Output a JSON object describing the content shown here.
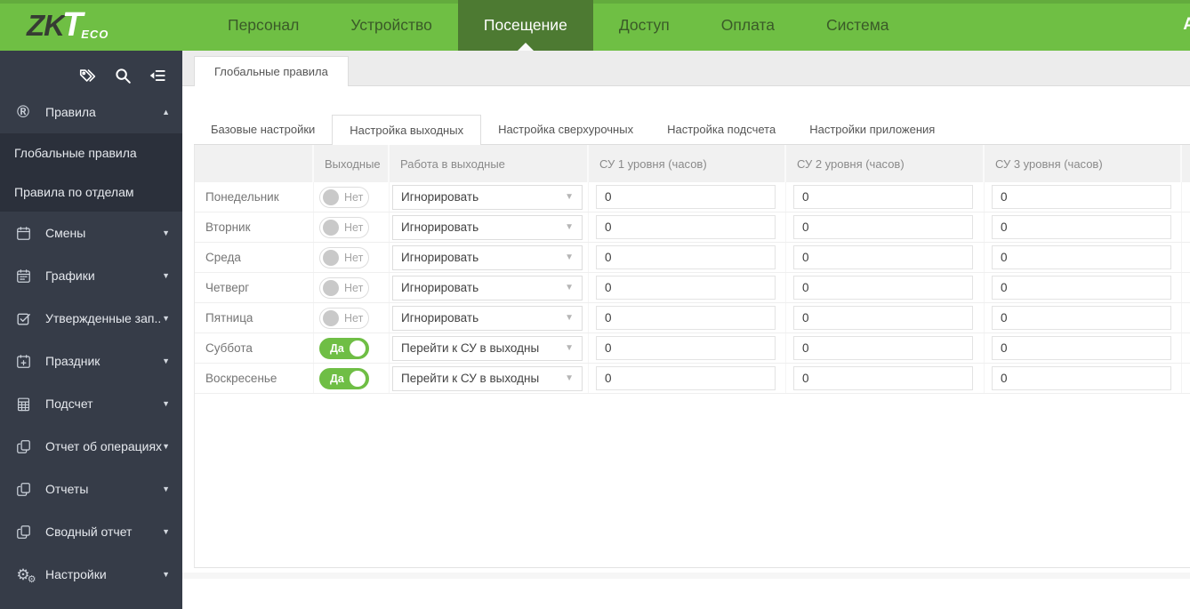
{
  "header": {
    "logo": {
      "zk": "ZK",
      "t": "T",
      "eco": "ECO"
    },
    "nav": [
      {
        "label": "Персонал",
        "active": false
      },
      {
        "label": "Устройство",
        "active": false
      },
      {
        "label": "Посещение",
        "active": true
      },
      {
        "label": "Доступ",
        "active": false
      },
      {
        "label": "Оплата",
        "active": false
      },
      {
        "label": "Система",
        "active": false
      }
    ],
    "user_label": "A"
  },
  "sidebar": {
    "tools": [
      "tags-icon",
      "search-icon",
      "collapse-menu-icon"
    ],
    "items": [
      {
        "label": "Правила",
        "icon": "registered-icon",
        "expanded": true,
        "submenu": [
          "Глобальные правила",
          "Правила по отделам"
        ]
      },
      {
        "label": "Смены",
        "icon": "calendar-icon"
      },
      {
        "label": "Графики",
        "icon": "schedule-calendar-icon"
      },
      {
        "label": "Утвержденные зап...",
        "icon": "approved-checkbox-icon"
      },
      {
        "label": "Праздник",
        "icon": "calendar-plus-icon"
      },
      {
        "label": "Подсчет",
        "icon": "calculator-grid-icon"
      },
      {
        "label": "Отчет об операциях",
        "icon": "report-pages-icon"
      },
      {
        "label": "Отчеты",
        "icon": "report-pages-icon"
      },
      {
        "label": "Сводный отчет",
        "icon": "report-pages-icon"
      },
      {
        "label": "Настройки",
        "icon": "gears-icon"
      }
    ]
  },
  "main": {
    "page_tab": "Глобальные правила",
    "sub_tabs": [
      "Базовые настройки",
      "Настройка выходных",
      "Настройка сверхурочных",
      "Настройка подсчета",
      "Настройки приложения"
    ],
    "active_sub_tab": 1,
    "table": {
      "columns": [
        "",
        "Выходные",
        "Работа в выходные",
        "СУ 1 уровня (часов)",
        "СУ 2 уровня (часов)",
        "СУ 3 уровня (часов)"
      ],
      "rows": [
        {
          "day": "Понедельник",
          "weekend": "Нет",
          "weekend_on": false,
          "work_mode": "Игнорировать",
          "su1": "0",
          "su2": "0",
          "su3": "0"
        },
        {
          "day": "Вторник",
          "weekend": "Нет",
          "weekend_on": false,
          "work_mode": "Игнорировать",
          "su1": "0",
          "su2": "0",
          "su3": "0"
        },
        {
          "day": "Среда",
          "weekend": "Нет",
          "weekend_on": false,
          "work_mode": "Игнорировать",
          "su1": "0",
          "su2": "0",
          "su3": "0"
        },
        {
          "day": "Четверг",
          "weekend": "Нет",
          "weekend_on": false,
          "work_mode": "Игнорировать",
          "su1": "0",
          "su2": "0",
          "su3": "0"
        },
        {
          "day": "Пятница",
          "weekend": "Нет",
          "weekend_on": false,
          "work_mode": "Игнорировать",
          "su1": "0",
          "su2": "0",
          "su3": "0"
        },
        {
          "day": "Суббота",
          "weekend": "Да",
          "weekend_on": true,
          "work_mode": "Перейти к СУ в выходны",
          "su1": "0",
          "su2": "0",
          "su3": "0"
        },
        {
          "day": "Воскресенье",
          "weekend": "Да",
          "weekend_on": true,
          "work_mode": "Перейти к СУ в выходны",
          "su1": "0",
          "su2": "0",
          "su3": "0"
        }
      ]
    }
  },
  "colors": {
    "brand_green": "#6fbf44",
    "active_nav_green": "#4d7a32",
    "toggle_on_green": "#6fbe45",
    "sidebar_bg": "#363c48"
  }
}
